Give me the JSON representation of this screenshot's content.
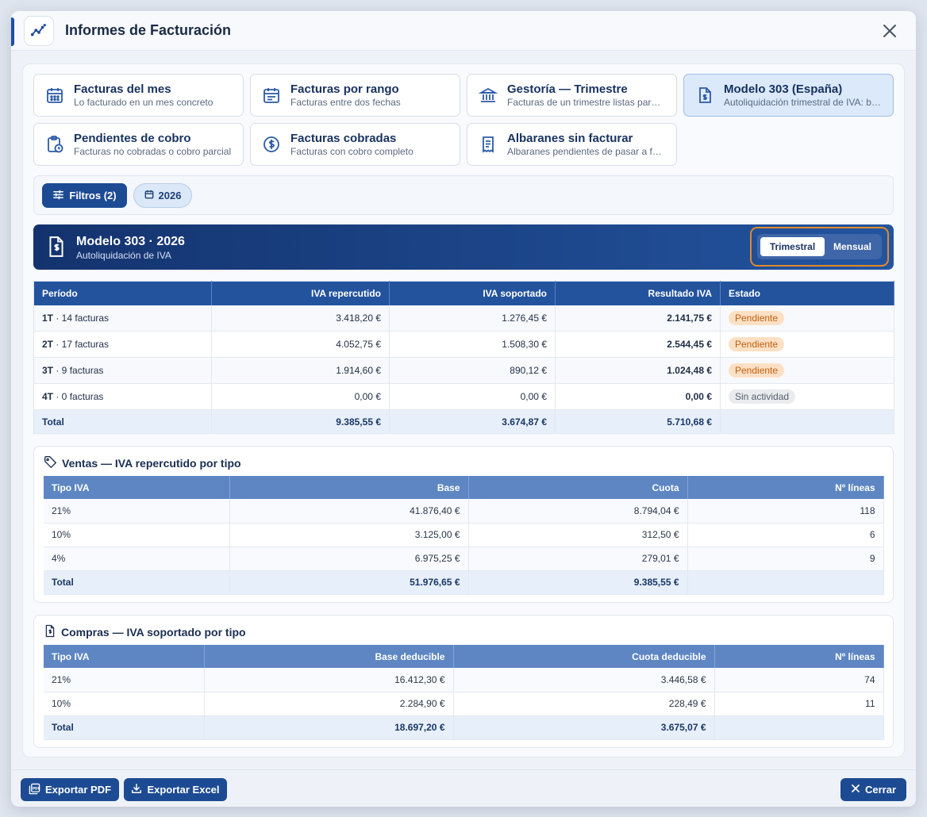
{
  "window": {
    "title": "Informes de Facturación"
  },
  "reports": [
    {
      "title": "Facturas del mes",
      "desc": "Lo facturado en un mes concreto",
      "icon": "calendar-icon"
    },
    {
      "title": "Facturas por rango",
      "desc": "Facturas entre dos fechas",
      "icon": "calendar-range-icon"
    },
    {
      "title": "Gestoría — Trimestre",
      "desc": "Facturas de un trimestre listas para …",
      "icon": "bank-icon"
    },
    {
      "title": "Modelo 303 (España)",
      "desc": "Autoliquidación trimestral de IVA: b…",
      "icon": "invoice-file-icon"
    },
    {
      "title": "Pendientes de cobro",
      "desc": "Facturas no cobradas o cobro parcial",
      "icon": "clipboard-clock-icon"
    },
    {
      "title": "Facturas cobradas",
      "desc": "Facturas con cobro completo",
      "icon": "dollar-circle-icon"
    },
    {
      "title": "Albaranes sin facturar",
      "desc": "Albaranes pendientes de pasar a fa…",
      "icon": "receipt-icon"
    }
  ],
  "filters": {
    "button": "Filtros (2)",
    "year_chip": "2026"
  },
  "banner": {
    "title": "Modelo 303 · 2026",
    "subtitle": "Autoliquidación de IVA",
    "toggle_on": "Trimestral",
    "toggle_off": "Mensual"
  },
  "main_table": {
    "headers": [
      "Período",
      "IVA repercutido",
      "IVA soportado",
      "Resultado IVA",
      "Estado"
    ],
    "rows": [
      {
        "q": "1T",
        "count": " · 14 facturas",
        "rep": "3.418,20 €",
        "sop": "1.276,45 €",
        "res": "2.141,75 €",
        "status": "Pendiente"
      },
      {
        "q": "2T",
        "count": " · 17 facturas",
        "rep": "4.052,75 €",
        "sop": "1.508,30 €",
        "res": "2.544,45 €",
        "status": "Pendiente"
      },
      {
        "q": "3T",
        "count": " · 9 facturas",
        "rep": "1.914,60 €",
        "sop": "890,12 €",
        "res": "1.024,48 €",
        "status": "Pendiente"
      },
      {
        "q": "4T",
        "count": " · 0 facturas",
        "rep": "0,00 €",
        "sop": "0,00 €",
        "res": "0,00 €",
        "status": "Sin actividad"
      }
    ],
    "total": {
      "label": "Total",
      "rep": "9.385,55 €",
      "sop": "3.674,87 €",
      "res": "5.710,68 €"
    }
  },
  "ventas": {
    "title": "Ventas — IVA repercutido por tipo",
    "headers": [
      "Tipo IVA",
      "Base",
      "Cuota",
      "Nº líneas"
    ],
    "rows": [
      [
        "21%",
        "41.876,40 €",
        "8.794,04 €",
        "118"
      ],
      [
        "10%",
        "3.125,00 €",
        "312,50 €",
        "6"
      ],
      [
        "4%",
        "6.975,25 €",
        "279,01 €",
        "9"
      ]
    ],
    "total": [
      "Total",
      "51.976,65 €",
      "9.385,55 €",
      ""
    ]
  },
  "compras": {
    "title": "Compras — IVA soportado por tipo",
    "headers": [
      "Tipo IVA",
      "Base deducible",
      "Cuota deducible",
      "Nº líneas"
    ],
    "rows": [
      [
        "21%",
        "16.412,30 €",
        "3.446,58 €",
        "74"
      ],
      [
        "10%",
        "2.284,90 €",
        "228,49 €",
        "11"
      ]
    ],
    "total": [
      "Total",
      "18.697,20 €",
      "3.675,07 €",
      ""
    ]
  },
  "footer": {
    "pdf": "Exportar PDF",
    "excel": "Exportar Excel",
    "close": "Cerrar"
  },
  "colors": {
    "primary": "#1d4b93",
    "accent_outline": "#e08a2b",
    "pending_bg": "#fde0c4",
    "pending_text": "#c05f12"
  }
}
